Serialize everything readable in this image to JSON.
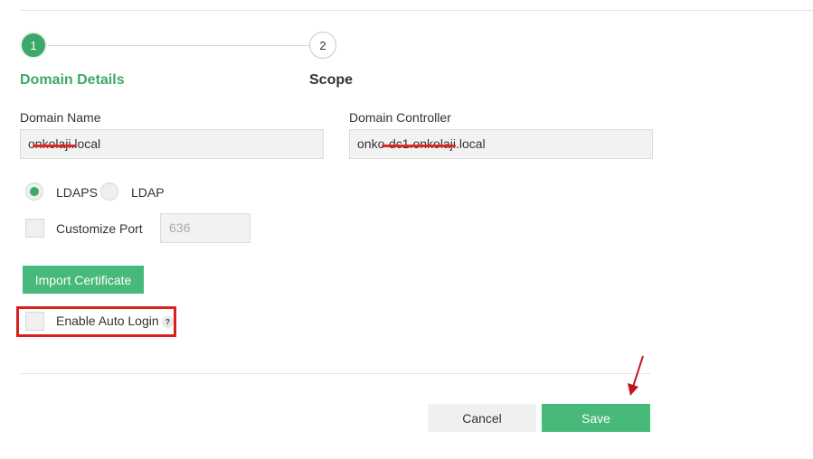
{
  "wizard": {
    "steps": [
      {
        "number": "1",
        "label": "Domain Details"
      },
      {
        "number": "2",
        "label": "Scope"
      }
    ]
  },
  "form": {
    "domain_name_label": "Domain Name",
    "domain_name_value": "onkolaji.local",
    "domain_controller_label": "Domain Controller",
    "domain_controller_value": "onko-dc1.onkolaji.local",
    "protocol_options": [
      "LDAPS",
      "LDAP"
    ],
    "protocol_selected": "LDAPS",
    "customize_port_label": "Customize Port",
    "port_placeholder": "636",
    "import_certificate_label": "Import Certificate",
    "enable_auto_login_label": "Enable Auto Login",
    "help_glyph": "?"
  },
  "footer": {
    "cancel_label": "Cancel",
    "save_label": "Save"
  },
  "annotations": {
    "highlight_color": "#d9201c",
    "arrow_color": "#c0151a"
  },
  "colors": {
    "accent": "#3ea86a",
    "button_green": "#47b97a"
  }
}
